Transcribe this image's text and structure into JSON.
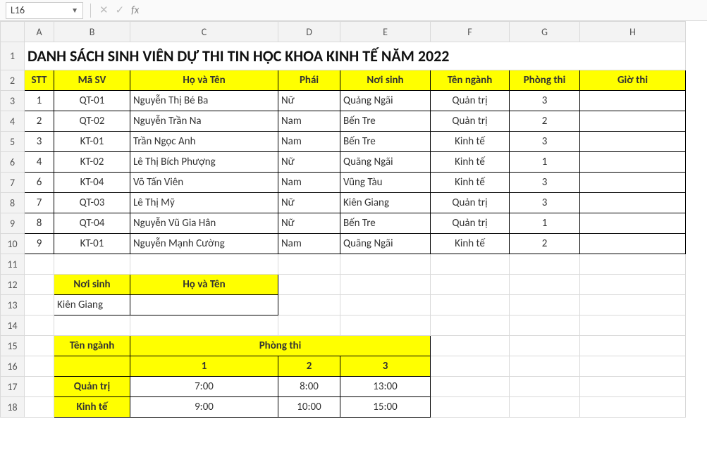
{
  "namebox": {
    "ref": "L16"
  },
  "formula_bar": {
    "value": ""
  },
  "colHeaders": [
    "A",
    "B",
    "C",
    "D",
    "E",
    "F",
    "G",
    "H"
  ],
  "rowHeaders": [
    "1",
    "2",
    "3",
    "4",
    "5",
    "6",
    "7",
    "8",
    "9",
    "10",
    "11",
    "12",
    "13",
    "14",
    "15",
    "16",
    "17",
    "18"
  ],
  "title": "DANH SÁCH SINH VIÊN DỰ THI TIN HỌC KHOA KINH TẾ NĂM 2022",
  "headers": {
    "stt": "STT",
    "masv": "Mã SV",
    "hoten": "Họ và Tên",
    "phai": "Phái",
    "noisinh": "Nơi sinh",
    "tennganh": "Tên ngành",
    "phongthi": "Phòng thi",
    "giothi": "Giờ thi"
  },
  "rows": [
    {
      "stt": "1",
      "masv": "QT-01",
      "hoten": "Nguyễn Thị Bé Ba",
      "phai": "Nữ",
      "noisinh": "Quảng Ngãi",
      "tennganh": "Quản trị",
      "phongthi": "3",
      "giothi": ""
    },
    {
      "stt": "2",
      "masv": "QT-02",
      "hoten": "Nguyễn Trần Na",
      "phai": "Nam",
      "noisinh": "Bến Tre",
      "tennganh": "Quản trị",
      "phongthi": "2",
      "giothi": ""
    },
    {
      "stt": "3",
      "masv": "KT-01",
      "hoten": "Trần Ngọc Anh",
      "phai": "Nam",
      "noisinh": "Bến Tre",
      "tennganh": "Kinh tế",
      "phongthi": "3",
      "giothi": ""
    },
    {
      "stt": "4",
      "masv": "KT-02",
      "hoten": "Lê Thị Bích Phượng",
      "phai": "Nữ",
      "noisinh": "Quãng Ngãi",
      "tennganh": "Kinh tế",
      "phongthi": "1",
      "giothi": ""
    },
    {
      "stt": "6",
      "masv": "KT-04",
      "hoten": "Võ Tấn Viên",
      "phai": "Nam",
      "noisinh": "Vũng Tàu",
      "tennganh": "Kinh tế",
      "phongthi": "3",
      "giothi": ""
    },
    {
      "stt": "7",
      "masv": "QT-03",
      "hoten": "Lê Thị Mỹ",
      "phai": "Nữ",
      "noisinh": "Kiên Giang",
      "tennganh": "Quản trị",
      "phongthi": "3",
      "giothi": ""
    },
    {
      "stt": "8",
      "masv": "QT-04",
      "hoten": "Nguyễn Vũ Gia Hân",
      "phai": "Nữ",
      "noisinh": "Bến Tre",
      "tennganh": "Quản trị",
      "phongthi": "1",
      "giothi": ""
    },
    {
      "stt": "9",
      "masv": "KT-01",
      "hoten": "Nguyễn Mạnh Cường",
      "phai": "Nam",
      "noisinh": "Quãng Ngãi",
      "tennganh": "Kinh tế",
      "phongthi": "2",
      "giothi": ""
    }
  ],
  "lookup1": {
    "h_noisinh": "Nơi sinh",
    "h_hoten": "Họ và Tên",
    "v_noisinh": "Kiên Giang",
    "v_hoten": ""
  },
  "lookup2": {
    "h_tennganh": "Tên ngành",
    "h_phongthi": "Phòng thi",
    "cols": {
      "c1": "1",
      "c2": "2",
      "c3": "3"
    },
    "r1": {
      "label": "Quản trị",
      "c1": "7:00",
      "c2": "8:00",
      "c3": "13:00"
    },
    "r2": {
      "label": "Kinh tế",
      "c1": "9:00",
      "c2": "10:00",
      "c3": "15:00"
    }
  }
}
